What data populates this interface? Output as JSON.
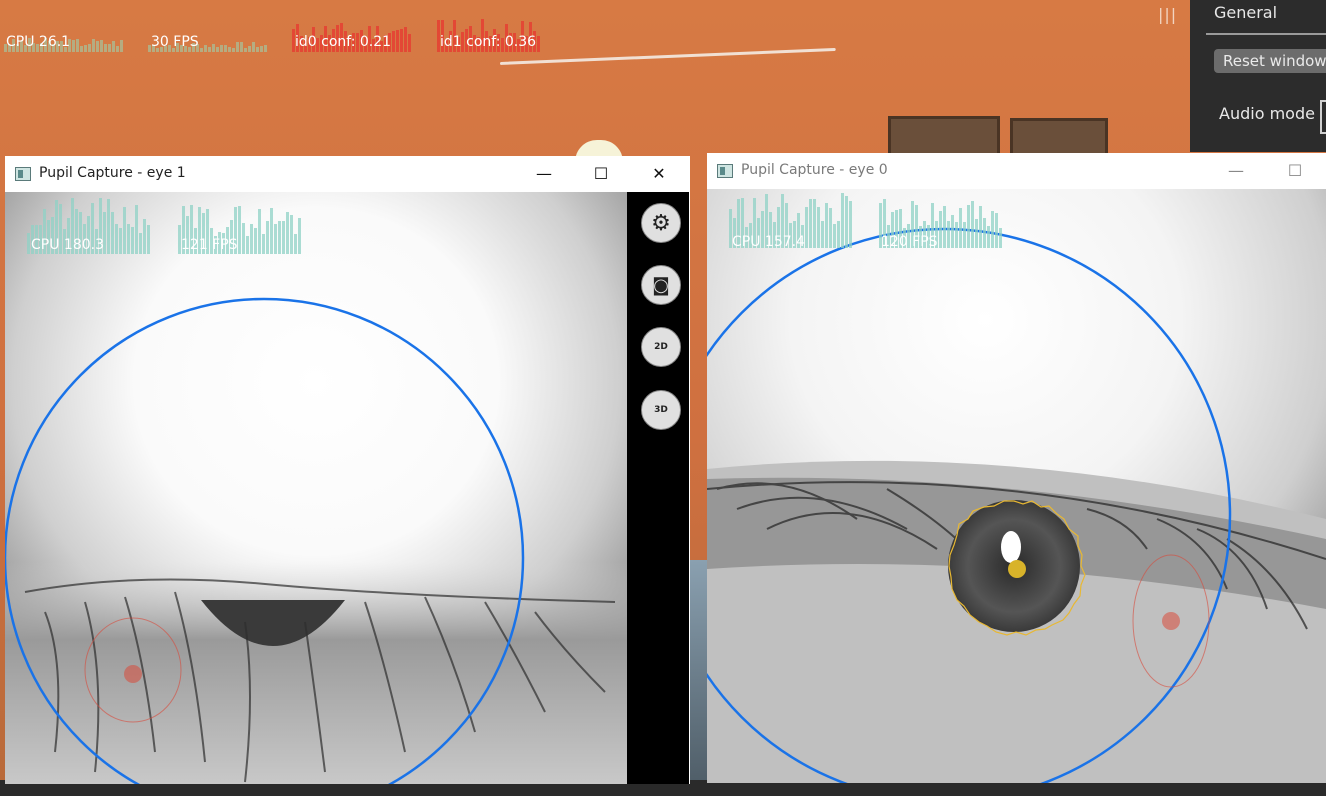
{
  "world_hud": {
    "cpu_label": "CPU 26.1",
    "fps_label": "30 FPS",
    "id0_label": "id0 conf: 0.21",
    "id1_label": "id1 conf: 0.36"
  },
  "general_panel": {
    "title": "General",
    "reset_button": "Reset window",
    "audio_mode_label": "Audio mode",
    "menu_handle_glyph": "|||"
  },
  "eye1_window": {
    "title": "Pupil Capture - eye 1",
    "minimize_glyph": "—",
    "maximize_glyph": "☐",
    "close_glyph": "✕",
    "cpu_label": "CPU 180.3",
    "fps_label": "121 FPS",
    "toolbar": [
      {
        "icon": "gear-icon",
        "glyph": "⚙"
      },
      {
        "icon": "camera-icon",
        "glyph": "◙"
      },
      {
        "icon": "detect-2d-icon",
        "glyph": "2D"
      },
      {
        "icon": "detect-3d-icon",
        "glyph": "3D"
      }
    ]
  },
  "eye0_window": {
    "title": "Pupil Capture - eye 0",
    "minimize_glyph": "—",
    "maximize_glyph": "☐",
    "cpu_label": "CPU 157.4",
    "fps_label": "120 FPS"
  },
  "colors": {
    "eye_model_circle": "#1a73e8",
    "pupil_ellipse": "#e8b832",
    "confidence_low": "#d94a3a",
    "graph_teal": "#8fd1c5"
  }
}
